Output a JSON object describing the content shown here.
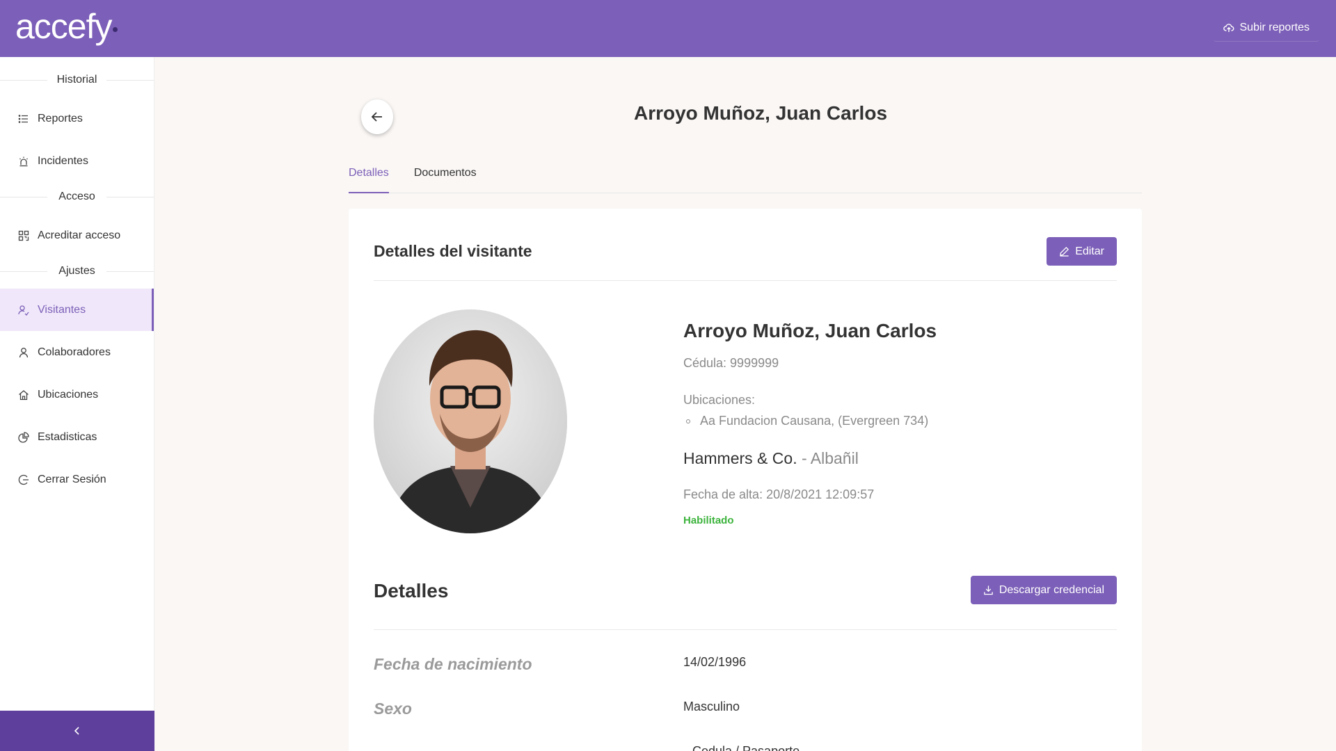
{
  "app": {
    "logo_text": "accefy",
    "upload_label": "Subir reportes"
  },
  "sidebar": {
    "sections": [
      {
        "title": "Historial",
        "items": [
          {
            "label": "Reportes",
            "icon": "list-icon"
          },
          {
            "label": "Incidentes",
            "icon": "alarm-icon"
          }
        ]
      },
      {
        "title": "Acceso",
        "items": [
          {
            "label": "Acreditar acceso",
            "icon": "qr-icon"
          }
        ]
      },
      {
        "title": "Ajustes",
        "items": [
          {
            "label": "Visitantes",
            "icon": "visitor-icon",
            "active": true
          },
          {
            "label": "Colaboradores",
            "icon": "user-icon"
          },
          {
            "label": "Ubicaciones",
            "icon": "home-icon"
          },
          {
            "label": "Estadisticas",
            "icon": "pie-chart-icon"
          },
          {
            "label": "Cerrar Sesión",
            "icon": "logout-icon"
          }
        ]
      }
    ]
  },
  "page": {
    "title": "Arroyo Muñoz, Juan Carlos",
    "tabs": [
      {
        "label": "Detalles",
        "active": true
      },
      {
        "label": "Documentos",
        "active": false
      }
    ]
  },
  "visitor_card": {
    "title": "Detalles del visitante",
    "edit_label": "Editar",
    "name": "Arroyo Muñoz, Juan Carlos",
    "cedula": "Cédula: 9999999",
    "locations_label": "Ubicaciones:",
    "locations": [
      "Aa Fundacion Causana, (Evergreen 734)"
    ],
    "company": "Hammers & Co.",
    "role": " - Albañil",
    "registration_date": "Fecha de alta: 20/8/2021 12:09:57",
    "status": "Habilitado"
  },
  "details": {
    "title": "Detalles",
    "download_label": "Descargar credencial",
    "rows": [
      {
        "label": "Fecha de nacimiento",
        "value": "14/02/1996"
      },
      {
        "label": "Sexo",
        "value": "Masculino"
      }
    ],
    "partial_value": "Cedula / Pasaporte"
  },
  "colors": {
    "primary": "#7c5fb8",
    "primary_dark": "#5e3f9c",
    "active_bg": "#f0e8fa",
    "status_green": "#3cb33c"
  }
}
